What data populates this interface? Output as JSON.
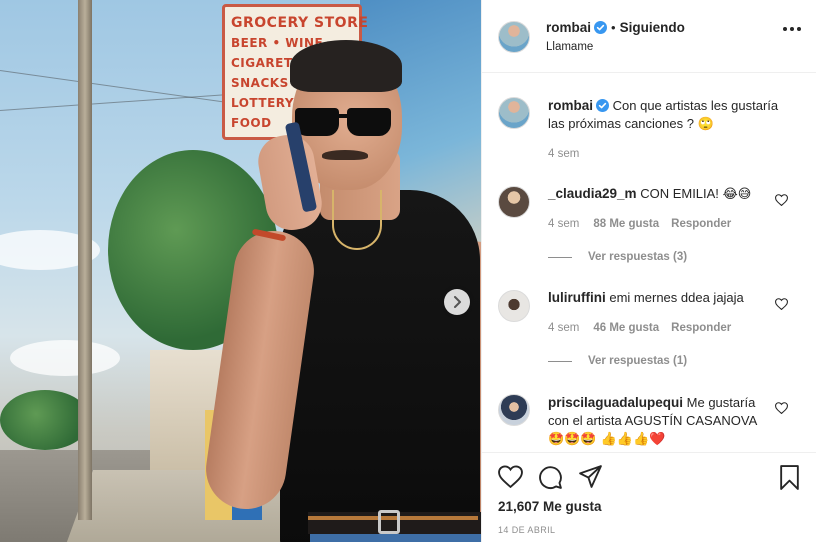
{
  "post": {
    "author": "rombai",
    "follow_separator": "•",
    "follow_status": "Siguiendo",
    "subtitle": "Llamame",
    "photo_sign": [
      "GROCERY STORE",
      "BEER • WINE",
      "CIGARETTES",
      "SNACKS",
      "LOTTERY",
      "FOOD"
    ]
  },
  "caption": {
    "author": "rombai",
    "text": "Con que artistas les gustaría las próximas canciones ?",
    "emoji": "🙄",
    "time": "4 sem"
  },
  "comments": [
    {
      "author": "_claudia29_m",
      "text": "CON EMILIA!",
      "emoji": "😂😅",
      "time": "4 sem",
      "likes": "88 Me gusta",
      "reply": "Responder",
      "view_replies": "Ver respuestas (3)"
    },
    {
      "author": "luliruffini",
      "text": "emi mernes ddea jajaja",
      "emoji": "",
      "time": "4 sem",
      "likes": "46 Me gusta",
      "reply": "Responder",
      "view_replies": "Ver respuestas (1)"
    },
    {
      "author": "priscilaguadalupequi",
      "text": "Me gustaría con el artista AGUSTÍN CASANOVA",
      "emoji": "🤩🤩🤩 👍👍👍❤️"
    }
  ],
  "footer": {
    "likes": "21,607 Me gusta",
    "date": "14 DE ABRIL"
  },
  "icons": {
    "verified": "verified-badge-icon",
    "more": "more-options-icon",
    "like": "heart-icon",
    "comment": "comment-icon",
    "share": "share-icon",
    "save": "bookmark-icon",
    "next": "chevron-right-icon"
  },
  "colors": {
    "verified_blue": "#3897f0",
    "text_primary": "#262626",
    "text_secondary": "#8e8e8e",
    "border": "#efefef"
  }
}
